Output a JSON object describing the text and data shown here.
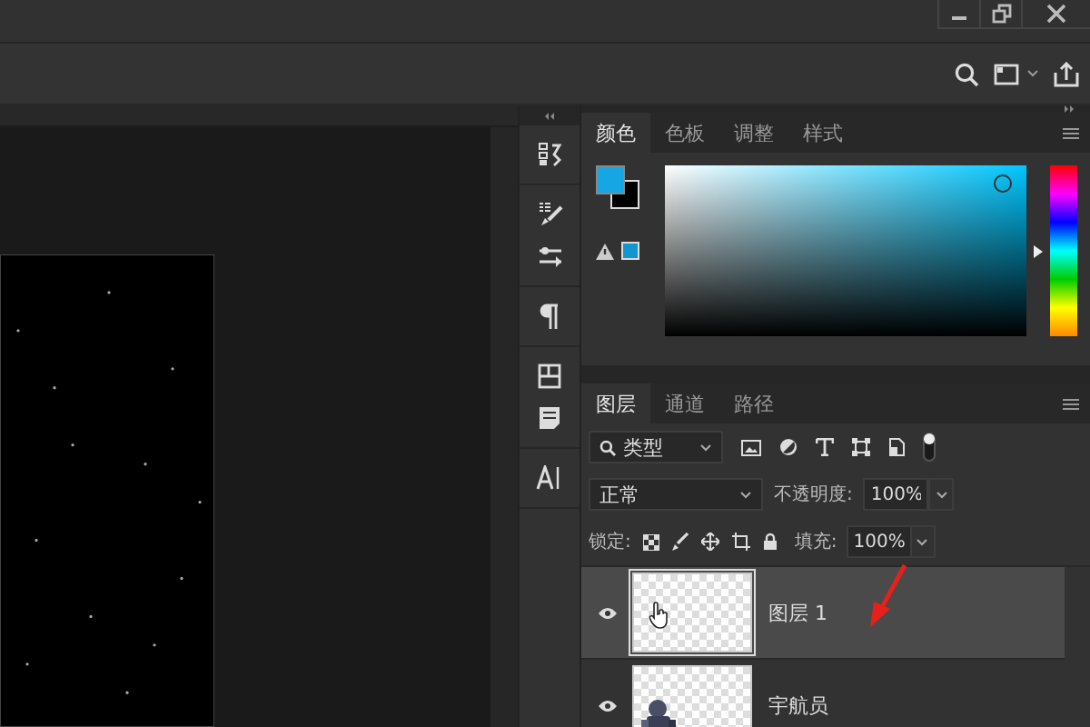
{
  "color_panel": {
    "tabs": [
      {
        "label": "颜色",
        "selected": true
      },
      {
        "label": "色板",
        "selected": false
      },
      {
        "label": "调整",
        "selected": false
      },
      {
        "label": "样式",
        "selected": false
      }
    ],
    "hue": {
      "level": 0.5
    }
  },
  "layers_panel": {
    "tabs": [
      {
        "label": "图层",
        "selected": true
      },
      {
        "label": "通道",
        "selected": false
      },
      {
        "label": "路径",
        "selected": false
      }
    ],
    "filter": {
      "value": "类型"
    },
    "blend_mode": {
      "value": "正常"
    },
    "opacity": {
      "label": "不透明度:",
      "value": "100%"
    },
    "lock": {
      "label": "锁定:"
    },
    "fill": {
      "label": "填充:",
      "value": "100%"
    },
    "layers": [
      {
        "name": "图层 1",
        "visible": true,
        "selected": true,
        "kind": "transparent"
      },
      {
        "name": "宇航员",
        "visible": true,
        "selected": false,
        "kind": "picture"
      }
    ]
  }
}
